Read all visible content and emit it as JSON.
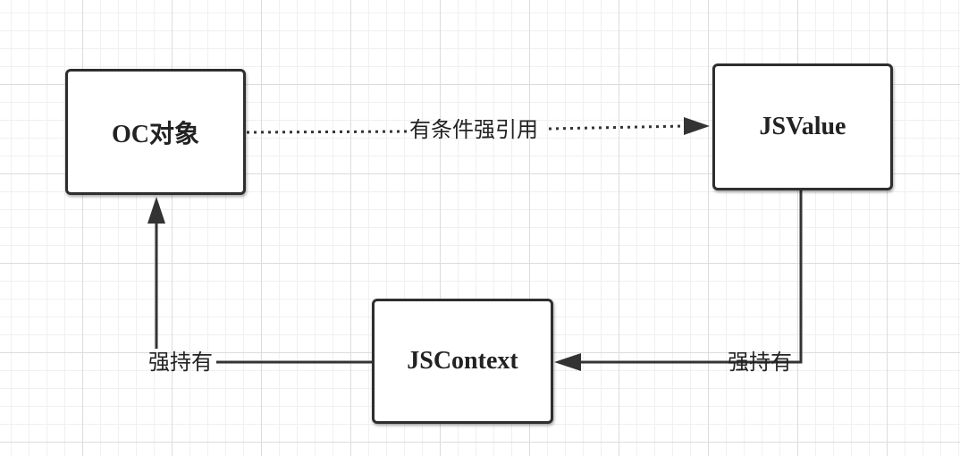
{
  "nodes": {
    "oc_object": "OC对象",
    "jsvalue": "JSValue",
    "jscontext": "JSContext"
  },
  "edges": {
    "oc_to_jsvalue": "有条件强引用",
    "jsvalue_to_jscontext": "强持有",
    "jscontext_to_oc": "强持有"
  },
  "colors": {
    "line": "#333333",
    "border": "#2e2e2e",
    "grid": "#dcdcdc"
  }
}
